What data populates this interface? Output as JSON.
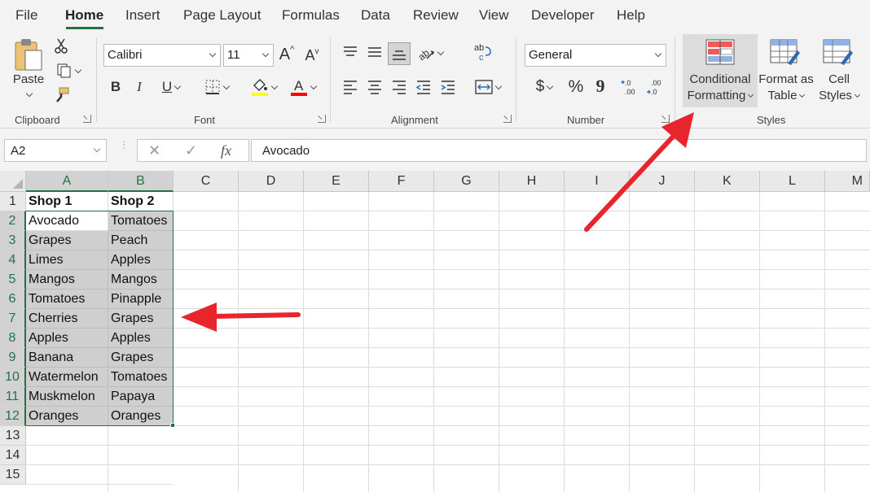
{
  "menu": {
    "tabs": [
      "File",
      "Home",
      "Insert",
      "Page Layout",
      "Formulas",
      "Data",
      "Review",
      "View",
      "Developer",
      "Help"
    ],
    "active": "Home"
  },
  "ribbon": {
    "clipboard": {
      "label": "Clipboard",
      "paste": "Paste"
    },
    "font": {
      "label": "Font",
      "family": "Calibri",
      "size": "11",
      "bold": "B",
      "italic": "I",
      "underline": "U",
      "grow": "A",
      "shrink": "A",
      "highlight_color": "#ffff00",
      "font_color": "#ff0000"
    },
    "alignment": {
      "label": "Alignment"
    },
    "number": {
      "label": "Number",
      "format": "General",
      "currency": "$",
      "percent": "%",
      "comma": "9"
    },
    "styles": {
      "label": "Styles",
      "conditional_formatting": [
        "Conditional",
        "Formatting"
      ],
      "format_as_table": [
        "Format as",
        "Table"
      ],
      "cell_styles": [
        "Cell",
        "Styles"
      ]
    }
  },
  "formula_bar": {
    "name_box": "A2",
    "cancel": "✕",
    "enter": "✓",
    "fx": "fx",
    "value": "Avocado"
  },
  "sheet": {
    "columns": [
      "A",
      "B",
      "C",
      "D",
      "E",
      "F",
      "G",
      "H",
      "I",
      "J",
      "K",
      "L",
      "M"
    ],
    "rows": [
      "1",
      "2",
      "3",
      "4",
      "5",
      "6",
      "7",
      "8",
      "9",
      "10",
      "11",
      "12",
      "13",
      "14",
      "15"
    ],
    "headers": [
      "Shop 1",
      "Shop 2"
    ],
    "data": [
      [
        "Avocado",
        "Tomatoes"
      ],
      [
        "Grapes",
        "Peach"
      ],
      [
        "Limes",
        "Apples"
      ],
      [
        "Mangos",
        "Mangos"
      ],
      [
        "Tomatoes",
        "Pinapple"
      ],
      [
        "Cherries",
        "Grapes"
      ],
      [
        "Apples",
        "Apples"
      ],
      [
        "Banana",
        "Grapes"
      ],
      [
        "Watermelon",
        "Tomatoes"
      ],
      [
        "Muskmelon",
        "Papaya"
      ],
      [
        "Oranges",
        "Oranges"
      ]
    ],
    "selection": "A2:B12",
    "active_cell": "A2"
  },
  "colors": {
    "accent": "#217346",
    "arrow": "#e8242c",
    "selection_fill": "#cfcfcf"
  }
}
